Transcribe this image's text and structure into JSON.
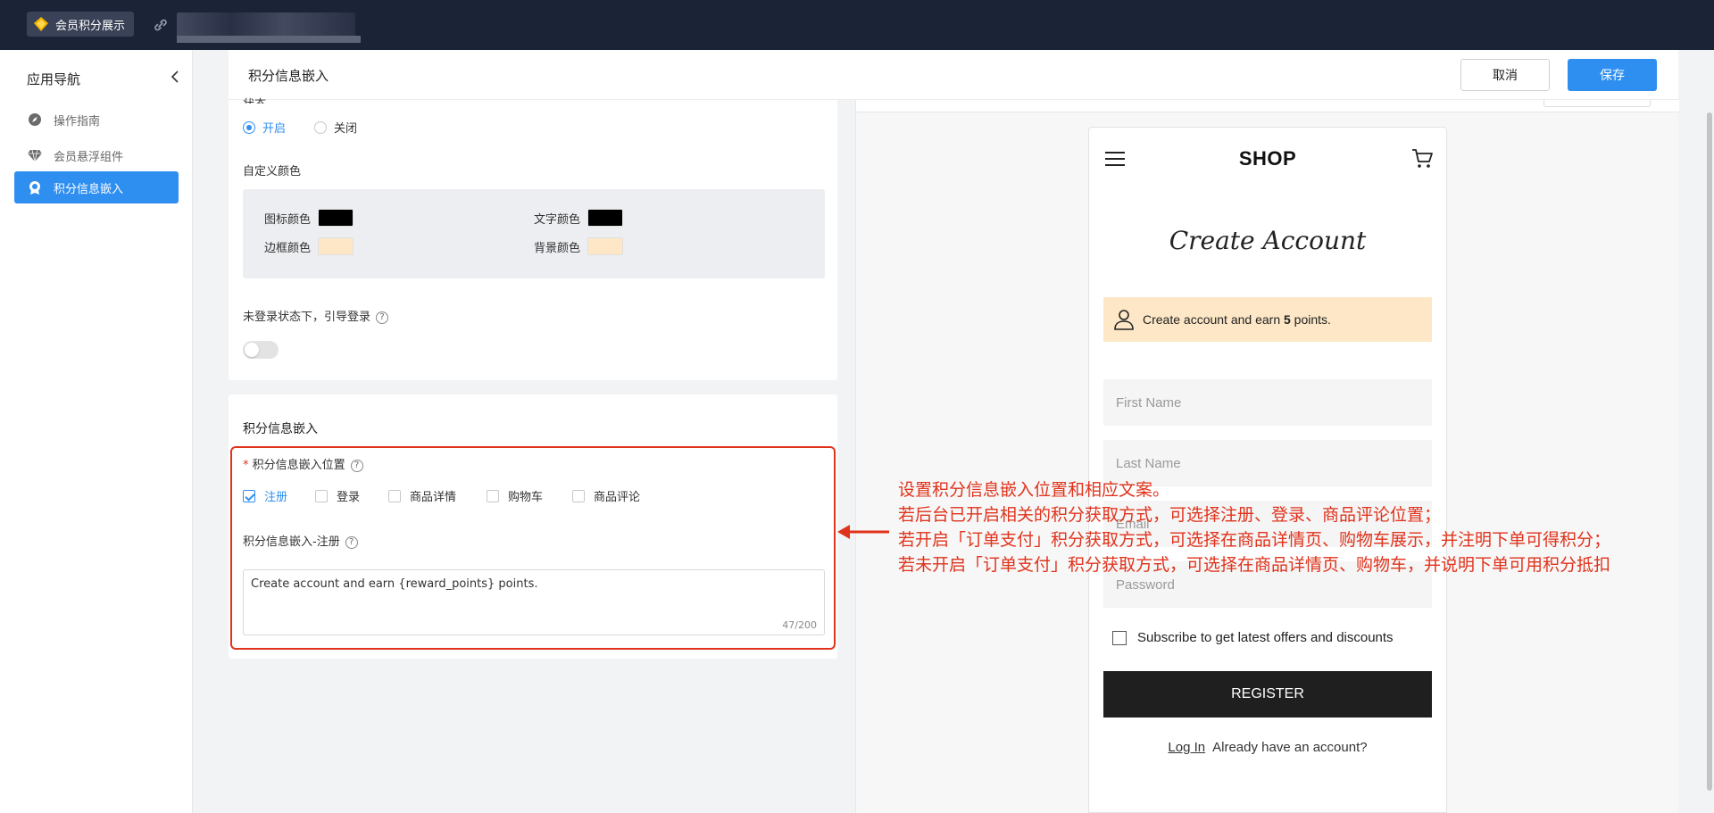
{
  "topbar": {
    "app_name": "会员积分展示"
  },
  "sidebar": {
    "title": "应用导航",
    "items": [
      {
        "label": "操作指南",
        "icon": "compass-icon"
      },
      {
        "label": "会员悬浮组件",
        "icon": "diamond-icon"
      },
      {
        "label": "积分信息嵌入",
        "icon": "badge-icon",
        "active": true
      }
    ]
  },
  "header": {
    "title": "积分信息嵌入",
    "cancel_label": "取消",
    "save_label": "保存"
  },
  "status": {
    "label": "状态",
    "on_label": "开启",
    "off_label": "关闭",
    "selected": "开启"
  },
  "custom_color": {
    "label": "自定义颜色",
    "icon_color_label": "图标颜色",
    "icon_color": "#000000",
    "text_color_label": "文字颜色",
    "text_color": "#000000",
    "border_color_label": "边框颜色",
    "border_color": "#fde7c6",
    "bg_color_label": "背景颜色",
    "bg_color": "#fde7c6"
  },
  "login_guide": {
    "label": "未登录状态下，引导登录",
    "enabled": false
  },
  "embed": {
    "section_title": "积分信息嵌入",
    "position_label": "积分信息嵌入位置",
    "required_mark": "*",
    "positions": [
      {
        "label": "注册",
        "checked": true
      },
      {
        "label": "登录",
        "checked": false
      },
      {
        "label": "商品详情",
        "checked": false
      },
      {
        "label": "购物车",
        "checked": false
      },
      {
        "label": "商品评论",
        "checked": false
      }
    ],
    "text_label": "积分信息嵌入-注册",
    "text_value": "Create account and earn {reward_points} points.",
    "counter": "47/200"
  },
  "preview": {
    "shop_name": "SHOP",
    "title": "Create Account",
    "earn_prefix": "Create account and earn ",
    "earn_points": "5",
    "earn_suffix": " points.",
    "fields": [
      "First Name",
      "Last Name",
      "Email",
      "Password"
    ],
    "subscribe_label": "Subscribe to get latest offers and discounts",
    "register_label": "REGISTER",
    "login_link": "Log In",
    "login_text": "Already have an account?"
  },
  "annotation": {
    "lines": [
      "设置积分信息嵌入位置和相应文案。",
      "若后台已开启相关的积分获取方式，可选择注册、登录、商品评论位置；",
      "若开启「订单支付」积分获取方式，可选择在商品详情页、购物车展示，并注明下单可得积分；",
      "若未开启「订单支付」积分获取方式，可选择在商品详情页、购物车，并说明下单可用积分抵扣"
    ]
  },
  "colors": {
    "accent": "#2f8ff0",
    "topbar": "#1b2337",
    "annotation": "#e0331c",
    "earn_bg": "#fde7c6"
  }
}
